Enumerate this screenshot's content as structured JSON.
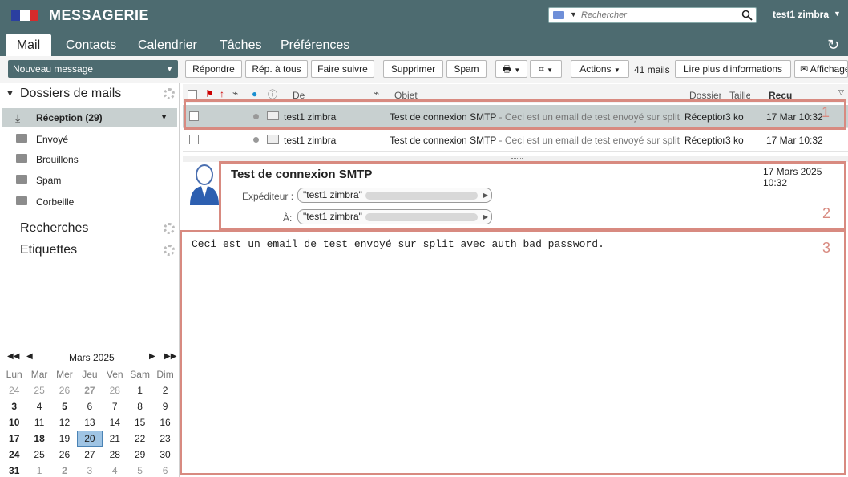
{
  "header": {
    "app_title": "MESSAGERIE",
    "search_placeholder": "Rechercher",
    "user": "test1 zimbra"
  },
  "tabs": [
    "Mail",
    "Contacts",
    "Calendrier",
    "Tâches",
    "Préférences"
  ],
  "toolbar": {
    "new_message": "Nouveau message",
    "reply": "Répondre",
    "reply_all": "Rép. à tous",
    "forward": "Faire suivre",
    "delete": "Supprimer",
    "spam": "Spam",
    "actions": "Actions",
    "mail_count": "41 mails",
    "more_info": "Lire plus d'informations",
    "display": "Affichage"
  },
  "sidebar": {
    "mail_folders_title": "Dossiers de mails",
    "inbox": "Réception (29)",
    "folders": [
      "Envoyé",
      "Brouillons",
      "Spam",
      "Corbeille"
    ],
    "searches": "Recherches",
    "tags": "Etiquettes"
  },
  "calendar": {
    "month": "Mars 2025",
    "days_of_week": [
      "Lun",
      "Mar",
      "Mer",
      "Jeu",
      "Ven",
      "Sam",
      "Dim"
    ],
    "weeks": [
      [
        "24",
        "25",
        "26",
        "27",
        "28",
        "1",
        "2"
      ],
      [
        "3",
        "4",
        "5",
        "6",
        "7",
        "8",
        "9"
      ],
      [
        "10",
        "11",
        "12",
        "13",
        "14",
        "15",
        "16"
      ],
      [
        "17",
        "18",
        "19",
        "20",
        "21",
        "22",
        "23"
      ],
      [
        "24",
        "25",
        "26",
        "27",
        "28",
        "29",
        "30"
      ],
      [
        "31",
        "1",
        "2",
        "3",
        "4",
        "5",
        "6"
      ]
    ]
  },
  "list": {
    "col_from": "De",
    "col_subject": "Objet",
    "col_folder": "Dossier",
    "col_size": "Taille",
    "col_received": "Reçu",
    "rows": [
      {
        "from": "test1 zimbra",
        "subject": "Test de connexion SMTP",
        "fragment": " - Ceci est un email de test envoyé sur split av",
        "folder": "Réception",
        "size": "3 ko",
        "date": "17 Mar 10:32"
      },
      {
        "from": "test1 zimbra",
        "subject": "Test de connexion SMTP",
        "fragment": " - Ceci est un email de test envoyé sur split av",
        "folder": "Réception",
        "size": "3 ko",
        "date": "17 Mar 10:32"
      }
    ]
  },
  "message": {
    "subject": "Test de connexion SMTP",
    "date": "17 Mars 2025 10:32",
    "from_label": "Expéditeur :",
    "to_label": "À:",
    "from_name": "\"test1 zimbra\"",
    "to_name": "\"test1 zimbra\"",
    "body": "Ceci est un email de test envoyé sur split avec auth bad password."
  },
  "annotations": [
    "1",
    "2",
    "3"
  ]
}
